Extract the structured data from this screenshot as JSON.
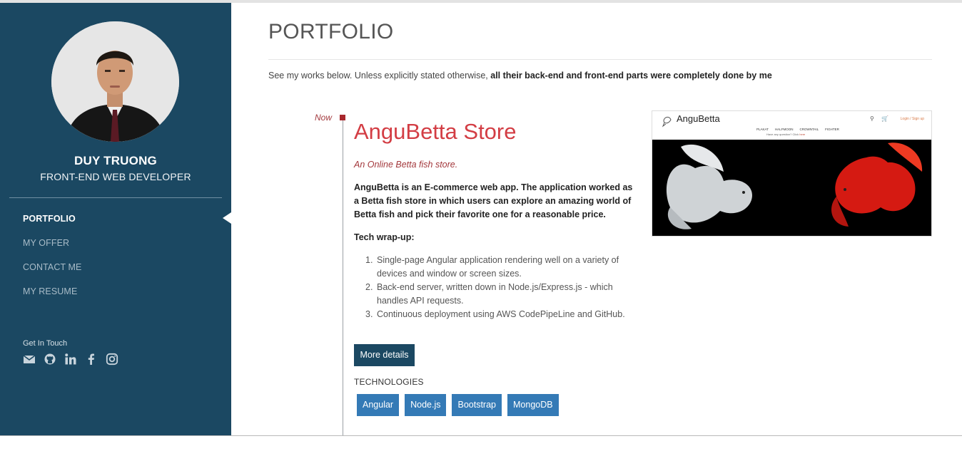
{
  "sidebar": {
    "name": "DUY TRUONG",
    "role": "FRONT-END WEB DEVELOPER",
    "nav": [
      {
        "label": "PORTFOLIO"
      },
      {
        "label": "MY OFFER"
      },
      {
        "label": "CONTACT ME"
      },
      {
        "label": "MY RESUME"
      }
    ],
    "active_nav": "PORTFOLIO",
    "get_in_touch": "Get In Touch",
    "social_icons": [
      "email-icon",
      "github-icon",
      "linkedin-icon",
      "facebook-icon",
      "instagram-icon"
    ]
  },
  "main": {
    "title": "PORTFOLIO",
    "intro_plain": "See my works below. Unless explicitly stated otherwise,",
    "intro_bold": "all their back-end and front-end parts were completely done by me",
    "project": {
      "timeline_label": "Now",
      "title": "AnguBetta Store",
      "subtitle": "An Online Betta fish store.",
      "description": "AnguBetta is an E-commerce web app. The application worked as a Betta fish store in which users can explore an amazing world of Betta fish and pick their favorite one for a reasonable price.",
      "tech_heading": "Tech wrap-up:",
      "tech_points": [
        {
          "num": "1.",
          "text": "Single-page Angular application rendering well on a variety of devices and window or screen sizes."
        },
        {
          "num": "2.",
          "text": "Back-end server, written down in Node.js/Express.js - which handles API requests."
        },
        {
          "num": "3.",
          "text": "Continuous deployment using AWS CodePipeLine and GitHub."
        }
      ],
      "more_button": "More details",
      "technologies_label": "TECHNOLOGIES",
      "technologies": [
        "Angular",
        "Node.js",
        "Bootstrap",
        "MongoDB"
      ],
      "preview": {
        "brand": "AnguBetta",
        "nav": [
          "PLAKAT",
          "HALFMOON",
          "CROWNTAIL",
          "FIGHTER"
        ],
        "help_text": "Have any question? Click",
        "help_link": "here",
        "login_text": "Login / Sign up"
      }
    }
  },
  "colors": {
    "sidebar_bg": "#1b4862",
    "accent_red": "#d33d44",
    "tag_blue": "#347ab6"
  }
}
